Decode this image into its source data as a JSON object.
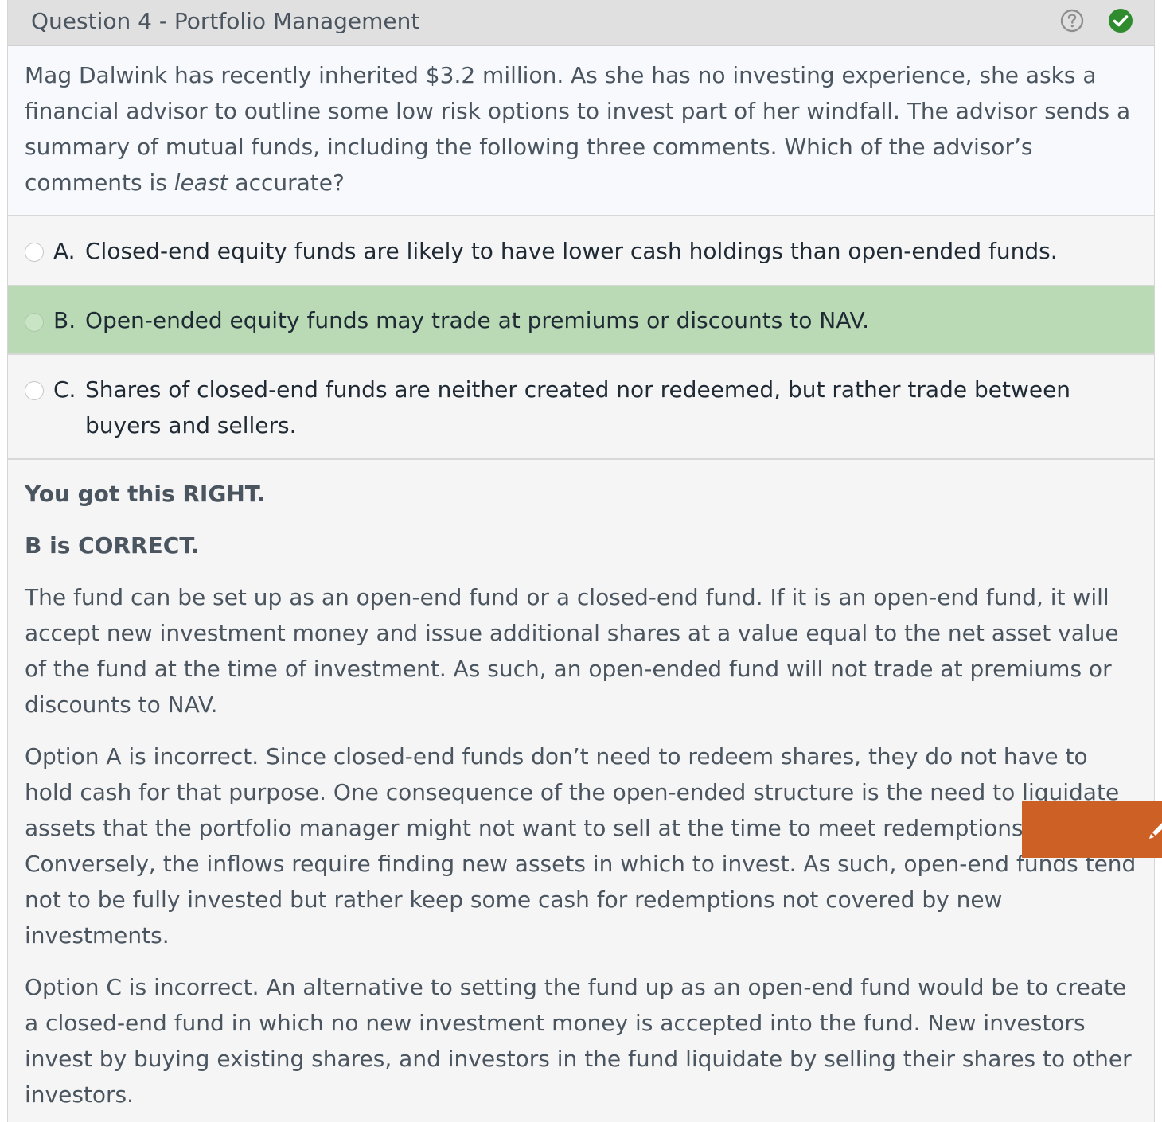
{
  "header": {
    "title": "Question 4 - Portfolio Management",
    "help_icon": "question-circle-icon",
    "status_icon": "check-circle-icon",
    "status_color": "#2e8b2e"
  },
  "question": {
    "stem_before": "Mag Dalwink has recently inherited $3.2 million. As she has no investing experience, she asks a financial advisor to outline some low risk options to invest part of her windfall. The advisor sends a summary of mutual funds, including the following three comments. Which of the advisor’s comments is ",
    "stem_emphasis": "least",
    "stem_after": " accurate?"
  },
  "options": [
    {
      "letter": "A.",
      "text": "Closed-end equity funds are likely to have lower cash holdings than open-ended funds.",
      "correct": false
    },
    {
      "letter": "B.",
      "text": "Open-ended equity funds may trade at premiums or discounts to NAV.",
      "correct": true
    },
    {
      "letter": "C.",
      "text": "Shares of closed-end funds are neither created nor redeemed, but rather trade between buyers and sellers.",
      "correct": false
    }
  ],
  "feedback": {
    "result": "You got this RIGHT.",
    "answer": "B is CORRECT.",
    "paragraphs": [
      "The fund can be set up as an open-end fund or a closed-end fund.  If it is an open-end fund, it will accept new investment money and issue additional shares at a value equal to the net asset value of the fund at the time of investment.  As such, an open-ended fund will not trade at premiums or discounts to NAV.",
      "Option A is incorrect.  Since closed-end funds don’t need to redeem shares, they do not have to hold cash for that purpose.  One consequence of the open-ended structure is the need to liquidate assets that the portfolio manager might not want to sell at the time to meet redemptions.  Conversely, the inflows require finding new assets in which to invest.  As such, open-end funds tend not to be fully invested but rather keep some cash for redemptions not covered by new investments.",
      "Option C is incorrect.  An alternative to setting the fund up as an open-end fund would be to create a closed-end fund in which no new investment money is accepted into the fund.  New investors invest by buying existing shares, and investors in the fund liquidate by selling their shares to other investors."
    ]
  },
  "annotation_tab": {
    "icon": "pencil-icon",
    "color": "#cd6125"
  }
}
